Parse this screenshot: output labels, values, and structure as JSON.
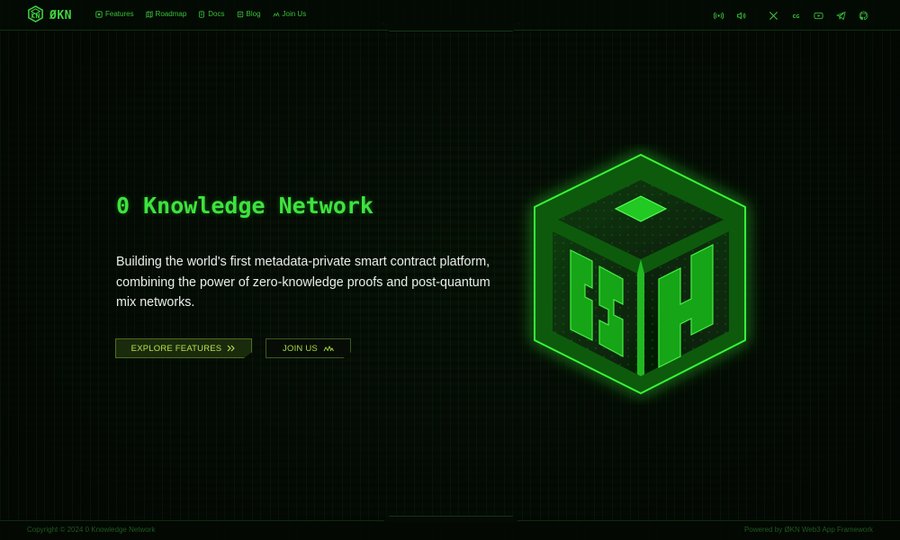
{
  "header": {
    "logo_text": "ØKN",
    "nav": [
      {
        "label": "Features",
        "icon": "features-icon"
      },
      {
        "label": "Roadmap",
        "icon": "roadmap-icon"
      },
      {
        "label": "Docs",
        "icon": "docs-icon"
      },
      {
        "label": "Blog",
        "icon": "blog-icon"
      },
      {
        "label": "Join Us",
        "icon": "join-icon"
      }
    ],
    "socials": [
      "broadcast-icon",
      "volume-icon",
      "x-icon",
      "coinmarketcap-icon",
      "youtube-icon",
      "telegram-icon",
      "github-icon"
    ]
  },
  "hero": {
    "title": "0 Knowledge Network",
    "description": "Building the world's first metadata-private smart contract platform, combining the power of zero-knowledge proofs and post-quantum mix networks.",
    "explore_label": "EXPLORE FEATURES",
    "join_label": "JOIN US"
  },
  "footer": {
    "copyright": "Copyright © 2024 0 Knowledge Network",
    "powered": "Powered by ØKN Web3 App Framework"
  },
  "colors": {
    "accent": "#3ee23e",
    "button_text": "#b8e24a",
    "background": "#040904"
  }
}
